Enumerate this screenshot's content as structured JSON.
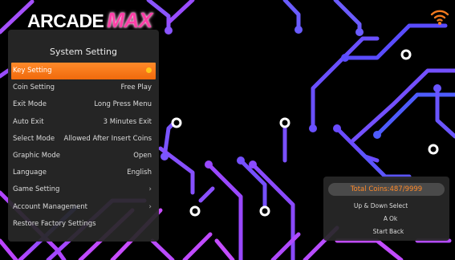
{
  "logo": {
    "word1": "ARCADE",
    "word2": "MAX"
  },
  "settings": {
    "title": "System Setting",
    "items": [
      {
        "label": "Key Setting",
        "value": "",
        "indicator": "dot",
        "selected": true
      },
      {
        "label": "Coin Setting",
        "value": "Free Play"
      },
      {
        "label": "Exit Mode",
        "value": "Long Press Menu"
      },
      {
        "label": "Auto Exit",
        "value": "3 Minutes Exit"
      },
      {
        "label": "Select Mode",
        "value": "Allowed After Insert Coins"
      },
      {
        "label": "Graphic Mode",
        "value": "Open"
      },
      {
        "label": "Language",
        "value": "English"
      },
      {
        "label": "Game Setting",
        "value": "",
        "indicator": "chevron"
      },
      {
        "label": "Account Management",
        "value": "",
        "indicator": "chevron"
      },
      {
        "label": "Restore Factory Settings",
        "value": ""
      }
    ]
  },
  "coins": {
    "total": "Total Coins:487/9999",
    "controls": [
      {
        "key": "Up & Down",
        "action": "Select"
      },
      {
        "key": "A",
        "action": "Ok"
      },
      {
        "key": "Start",
        "action": "Back"
      }
    ]
  },
  "icons": {
    "wifi": "wifi-icon",
    "selected_marker": "dot-icon",
    "submenu": "chevron-right-icon"
  },
  "colors": {
    "accent": "#f47a1e",
    "logo_pink": "#ff3fa8",
    "circuit_purple": "#6a4cff",
    "circuit_pink": "#c54bff",
    "panel_bg": "#282828",
    "coins_text": "#ff8a2a",
    "wifi": "#f47a1e"
  }
}
